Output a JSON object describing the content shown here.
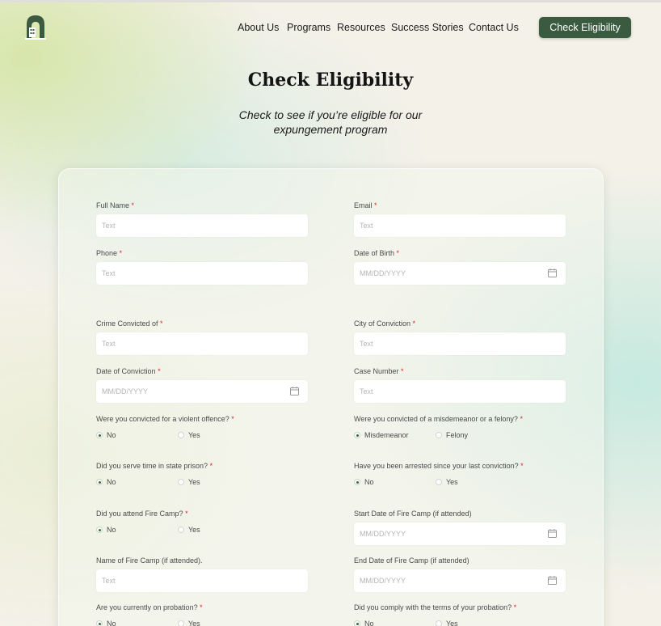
{
  "header": {
    "nav": [
      {
        "label": "About Us"
      },
      {
        "label": "Programs"
      },
      {
        "label": "Resources"
      },
      {
        "label": "Success Stories"
      },
      {
        "label": "Contact Us"
      }
    ],
    "cta_label": "Check Eligibility",
    "brand_color": "#3a5b3f"
  },
  "hero": {
    "title": "Check Eligibility",
    "subtitle_line1": "Check to see if you’re eligible for our",
    "subtitle_line2": "expungement program"
  },
  "form": {
    "required_mark": "*",
    "full_name": {
      "label": "Full Name",
      "placeholder": "Text"
    },
    "email": {
      "label": "Email",
      "placeholder": "Text"
    },
    "phone": {
      "label": "Phone",
      "placeholder": "Text"
    },
    "dob": {
      "label": "Date of Birth",
      "placeholder": "MM/DD/YYYY"
    },
    "crime": {
      "label": "Crime Convicted of",
      "placeholder": "Text"
    },
    "city": {
      "label": "City of Conviction",
      "placeholder": "Text"
    },
    "conviction_date": {
      "label": "Date of Conviction",
      "placeholder": "MM/DD/YYYY"
    },
    "case_number": {
      "label": "Case Number",
      "placeholder": "Text"
    },
    "violent": {
      "label": "Were you convicted for a violent offence?",
      "options": [
        "No",
        "Yes"
      ],
      "selected": "No"
    },
    "misdemeanor": {
      "label": "Were you convicted of a misdemeanor or a felony?",
      "options": [
        "Misdemeanor",
        "Felony"
      ],
      "selected": "Misdemeanor"
    },
    "prison": {
      "label": "Did you serve time in state prison?",
      "options": [
        "No",
        "Yes"
      ],
      "selected": "No"
    },
    "arrested": {
      "label": "Have you been arrested since your last conviction?",
      "options": [
        "No",
        "Yes"
      ],
      "selected": "No"
    },
    "fire_camp": {
      "label": "Did you attend Fire Camp?",
      "options": [
        "No",
        "Yes"
      ],
      "selected": "No"
    },
    "fire_start": {
      "label": "Start Date of Fire Camp (if attended)",
      "placeholder": "MM/DD/YYYY"
    },
    "fire_name": {
      "label": "Name of Fire Camp (if attended).",
      "placeholder": "Text"
    },
    "fire_end": {
      "label": "End Date of Fire Camp (if attended)",
      "placeholder": "MM/DD/YYYY"
    },
    "probation": {
      "label": "Are you currently on probation?",
      "options": [
        "No",
        "Yes"
      ],
      "selected": "No"
    },
    "comply": {
      "label": "Did you comply with the terms of your probation?",
      "options": [
        "No",
        "Yes"
      ],
      "selected": "No"
    }
  }
}
